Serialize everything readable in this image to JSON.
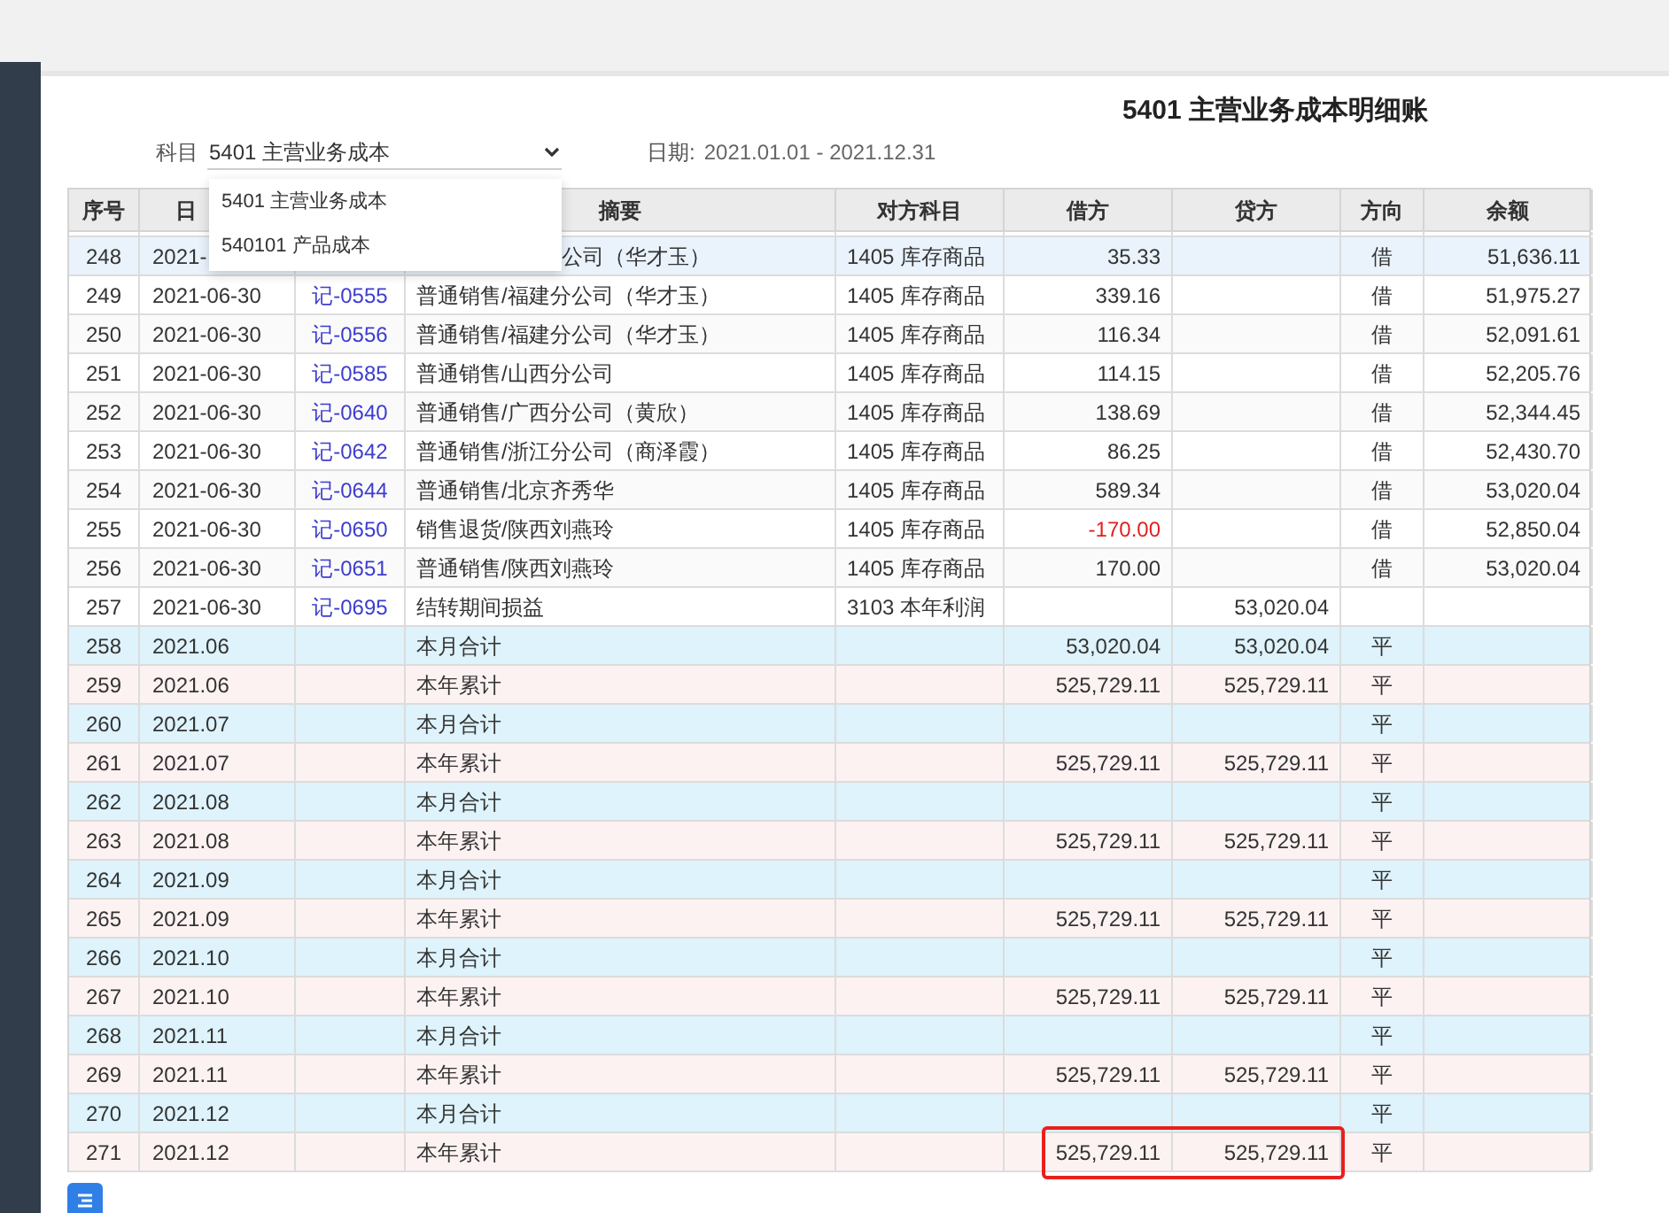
{
  "title": "5401 主营业务成本明细账",
  "filter": {
    "label": "科目",
    "value": "5401 主营业务成本",
    "date_label": "日期:",
    "date_value": "2021.01.01 - 2021.12.31"
  },
  "dropdown": {
    "options": [
      {
        "label": "5401 主营业务成本",
        "selected": false
      },
      {
        "label": "540101 产品成本",
        "selected": false
      }
    ]
  },
  "table": {
    "columns": [
      "序号",
      "日",
      "",
      "摘要",
      "对方科目",
      "借方",
      "贷方",
      "方向",
      "余额"
    ],
    "rows": [
      {
        "no": "248",
        "date": "2021-",
        "summary": "公司（华才玉）",
        "account": "1405 库存商品",
        "debit": "35.33",
        "direction": "借",
        "balance": "51,636.11",
        "kind": "entry",
        "selected": true,
        "debit_negative": false,
        "boxed": false
      },
      {
        "no": "249",
        "date": "2021-06-30",
        "voucher": "记-0555",
        "summary": "普通销售/福建分公司（华才玉）",
        "account": "1405 库存商品",
        "debit": "339.16",
        "direction": "借",
        "balance": "51,975.27",
        "kind": "entry",
        "selected": false,
        "debit_negative": false,
        "boxed": false
      },
      {
        "no": "250",
        "date": "2021-06-30",
        "voucher": "记-0556",
        "summary": "普通销售/福建分公司（华才玉）",
        "account": "1405 库存商品",
        "debit": "116.34",
        "direction": "借",
        "balance": "52,091.61",
        "kind": "entry",
        "selected": false,
        "debit_negative": false,
        "boxed": false
      },
      {
        "no": "251",
        "date": "2021-06-30",
        "voucher": "记-0585",
        "summary": "普通销售/山西分公司",
        "account": "1405 库存商品",
        "debit": "114.15",
        "direction": "借",
        "balance": "52,205.76",
        "kind": "entry",
        "selected": false,
        "debit_negative": false,
        "boxed": false
      },
      {
        "no": "252",
        "date": "2021-06-30",
        "voucher": "记-0640",
        "summary": "普通销售/广西分公司（黄欣）",
        "account": "1405 库存商品",
        "debit": "138.69",
        "direction": "借",
        "balance": "52,344.45",
        "kind": "entry",
        "selected": false,
        "debit_negative": false,
        "boxed": false
      },
      {
        "no": "253",
        "date": "2021-06-30",
        "voucher": "记-0642",
        "summary": "普通销售/浙江分公司（商泽霞）",
        "account": "1405 库存商品",
        "debit": "86.25",
        "direction": "借",
        "balance": "52,430.70",
        "kind": "entry",
        "selected": false,
        "debit_negative": false,
        "boxed": false
      },
      {
        "no": "254",
        "date": "2021-06-30",
        "voucher": "记-0644",
        "summary": "普通销售/北京齐秀华",
        "account": "1405 库存商品",
        "debit": "589.34",
        "direction": "借",
        "balance": "53,020.04",
        "kind": "entry",
        "selected": false,
        "debit_negative": false,
        "boxed": false
      },
      {
        "no": "255",
        "date": "2021-06-30",
        "voucher": "记-0650",
        "summary": "销售退货/陕西刘燕玲",
        "account": "1405 库存商品",
        "debit": "-170.00",
        "direction": "借",
        "balance": "52,850.04",
        "kind": "entry",
        "selected": false,
        "debit_negative": true,
        "boxed": false
      },
      {
        "no": "256",
        "date": "2021-06-30",
        "voucher": "记-0651",
        "summary": "普通销售/陕西刘燕玲",
        "account": "1405 库存商品",
        "debit": "170.00",
        "direction": "借",
        "balance": "53,020.04",
        "kind": "entry",
        "selected": false,
        "debit_negative": false,
        "boxed": false
      },
      {
        "no": "257",
        "date": "2021-06-30",
        "voucher": "记-0695",
        "summary": "结转期间损益",
        "account": "3103 本年利润",
        "credit": "53,020.04",
        "kind": "entry",
        "selected": false,
        "boxed": false
      },
      {
        "no": "258",
        "date": "2021.06",
        "summary": "本月合计",
        "debit": "53,020.04",
        "credit": "53,020.04",
        "direction": "平",
        "kind": "month_total",
        "selected": false,
        "debit_negative": false,
        "boxed": false
      },
      {
        "no": "259",
        "date": "2021.06",
        "summary": "本年累计",
        "debit": "525,729.11",
        "credit": "525,729.11",
        "direction": "平",
        "kind": "year_total",
        "selected": false,
        "debit_negative": false,
        "boxed": false
      },
      {
        "no": "260",
        "date": "2021.07",
        "summary": "本月合计",
        "direction": "平",
        "kind": "month_total",
        "selected": false,
        "boxed": false
      },
      {
        "no": "261",
        "date": "2021.07",
        "summary": "本年累计",
        "debit": "525,729.11",
        "credit": "525,729.11",
        "direction": "平",
        "kind": "year_total",
        "selected": false,
        "debit_negative": false,
        "boxed": false
      },
      {
        "no": "262",
        "date": "2021.08",
        "summary": "本月合计",
        "direction": "平",
        "kind": "month_total",
        "selected": false,
        "boxed": false
      },
      {
        "no": "263",
        "date": "2021.08",
        "summary": "本年累计",
        "debit": "525,729.11",
        "credit": "525,729.11",
        "direction": "平",
        "kind": "year_total",
        "selected": false,
        "debit_negative": false,
        "boxed": false
      },
      {
        "no": "264",
        "date": "2021.09",
        "summary": "本月合计",
        "direction": "平",
        "kind": "month_total",
        "selected": false,
        "boxed": false
      },
      {
        "no": "265",
        "date": "2021.09",
        "summary": "本年累计",
        "debit": "525,729.11",
        "credit": "525,729.11",
        "direction": "平",
        "kind": "year_total",
        "selected": false,
        "debit_negative": false,
        "boxed": false
      },
      {
        "no": "266",
        "date": "2021.10",
        "summary": "本月合计",
        "direction": "平",
        "kind": "month_total",
        "selected": false,
        "boxed": false
      },
      {
        "no": "267",
        "date": "2021.10",
        "summary": "本年累计",
        "debit": "525,729.11",
        "credit": "525,729.11",
        "direction": "平",
        "kind": "year_total",
        "selected": false,
        "debit_negative": false,
        "boxed": false
      },
      {
        "no": "268",
        "date": "2021.11",
        "summary": "本月合计",
        "direction": "平",
        "kind": "month_total",
        "selected": false,
        "boxed": false
      },
      {
        "no": "269",
        "date": "2021.11",
        "summary": "本年累计",
        "debit": "525,729.11",
        "credit": "525,729.11",
        "direction": "平",
        "kind": "year_total",
        "selected": false,
        "debit_negative": false,
        "boxed": false
      },
      {
        "no": "270",
        "date": "2021.12",
        "summary": "本月合计",
        "direction": "平",
        "kind": "month_total",
        "selected": false,
        "boxed": false
      },
      {
        "no": "271",
        "date": "2021.12",
        "summary": "本年累计",
        "debit": "525,729.11",
        "credit": "525,729.11",
        "direction": "平",
        "kind": "year_total",
        "selected": false,
        "debit_negative": false,
        "boxed": true
      }
    ]
  }
}
